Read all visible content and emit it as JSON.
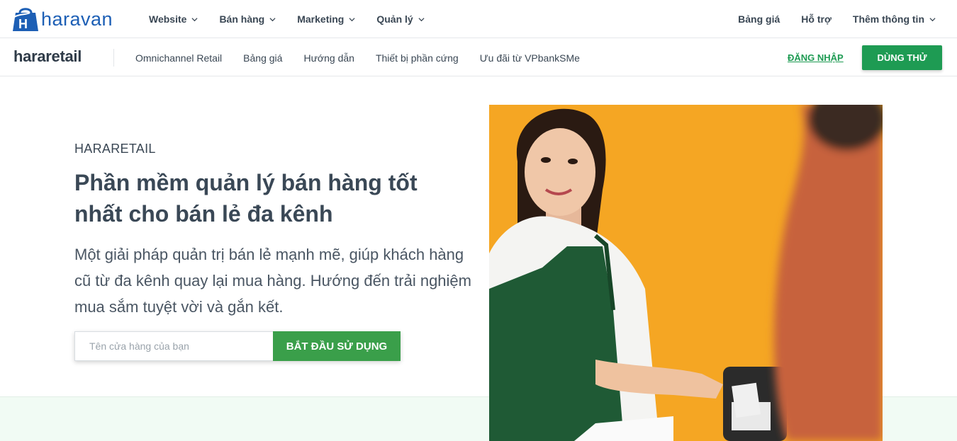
{
  "top_nav": {
    "logo_text": "haravan",
    "menu": [
      {
        "label": "Website"
      },
      {
        "label": "Bán hàng"
      },
      {
        "label": "Marketing"
      },
      {
        "label": "Quản lý"
      }
    ],
    "right": [
      {
        "label": "Bảng giá"
      },
      {
        "label": "Hỗ trợ"
      },
      {
        "label": "Thêm thông tin"
      }
    ]
  },
  "sub_nav": {
    "brand": "hararetail",
    "items": [
      {
        "label": "Omnichannel Retail"
      },
      {
        "label": "Bảng giá"
      },
      {
        "label": "Hướng dẫn"
      },
      {
        "label": "Thiết bị phần cứng"
      },
      {
        "label": "Ưu đãi từ VPbankSMe"
      }
    ],
    "login_label": "ĐĂNG NHẬP",
    "try_label": "DÙNG THỬ"
  },
  "hero": {
    "eyebrow": "HARARETAIL",
    "headline": "Phần mềm quản lý bán hàng tốt nhất cho bán lẻ đa kênh",
    "description": "Một giải pháp quản trị bán lẻ mạnh mẽ, giúp khách hàng cũ từ đa kênh quay lại mua hàng. Hướng đến trải nghiệm mua sắm tuyệt vời và gắn kết.",
    "input_placeholder": "Tên cửa hàng của bạn",
    "input_value": "",
    "cta_label": "BẮT ĐẦU SỬ DỤNG"
  },
  "colors": {
    "brand_blue": "#1d5fb5",
    "accent_green": "#1e9b53",
    "cta_green": "#3a9f4a",
    "photo_background": "#f5a623",
    "apron": "#1f5a35"
  }
}
